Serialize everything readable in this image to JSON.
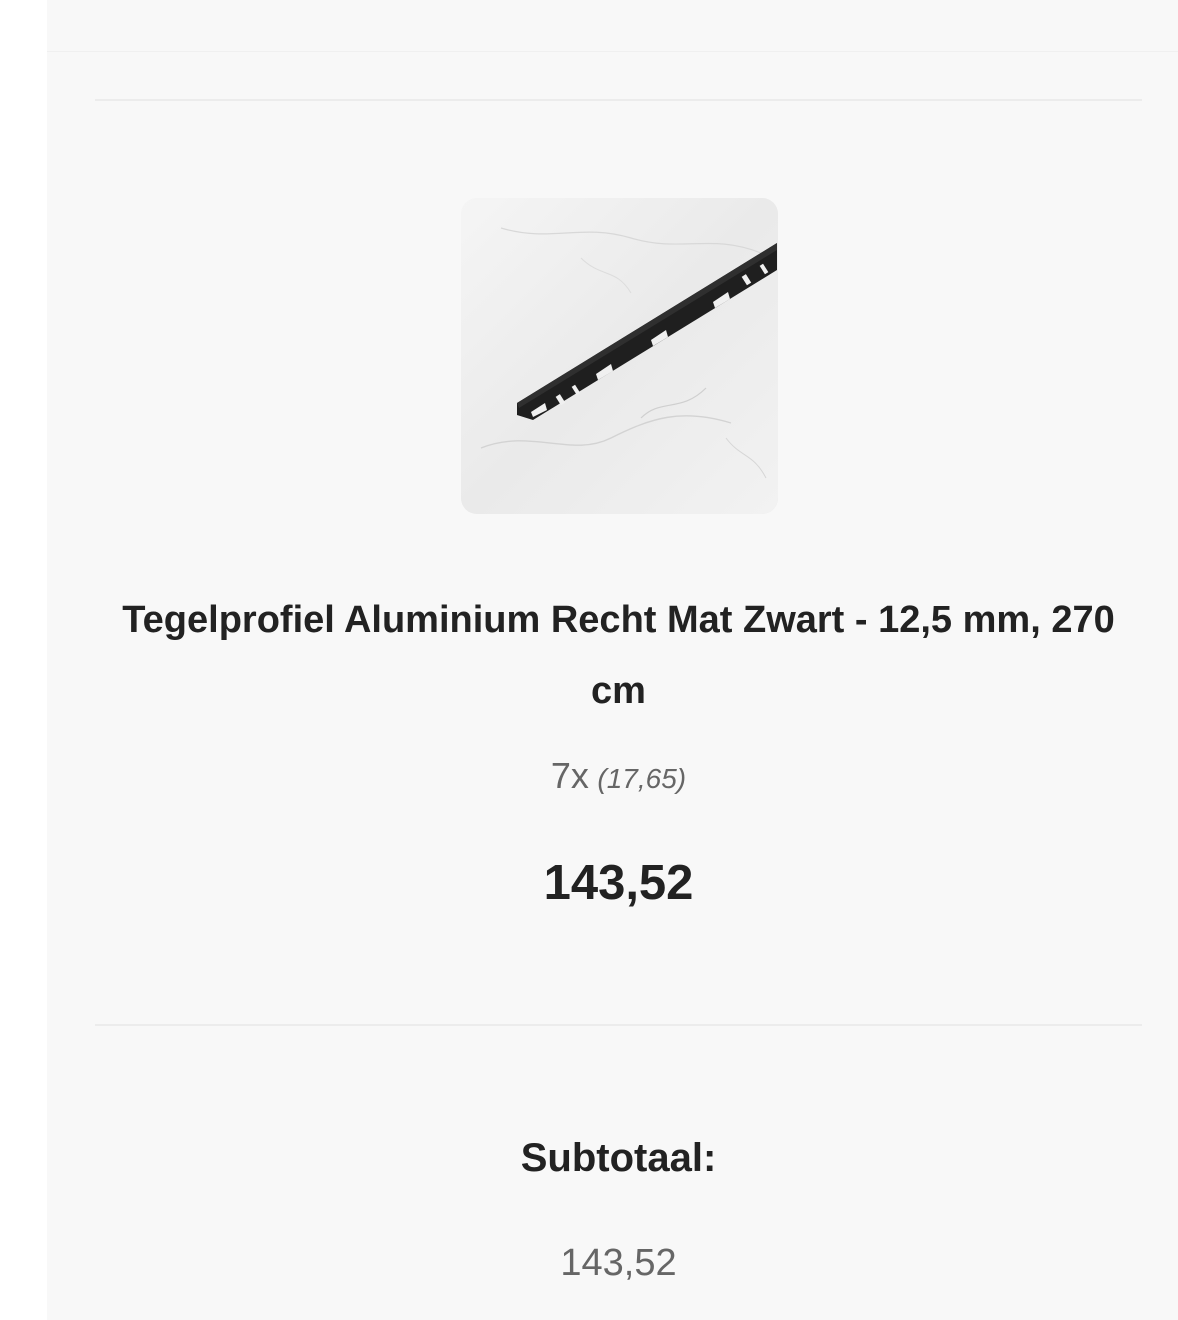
{
  "cart_item": {
    "image_alt": "Tegelprofiel Aluminium Recht Mat Zwart",
    "title": "Tegelprofiel Aluminium Recht Mat Zwart - 12,5 mm, 270 cm",
    "quantity": "7x",
    "unit_price": "(17,65)",
    "line_total": "143,52"
  },
  "summary": {
    "subtotal_label": "Subtotaal:",
    "subtotal_value": "143,52"
  },
  "colors": {
    "text_primary": "#222222",
    "text_secondary": "#666666",
    "panel_background": "#f8f8f8",
    "divider": "#ececec"
  },
  "icons": {
    "product_image": "tile-profile-product-photo"
  }
}
